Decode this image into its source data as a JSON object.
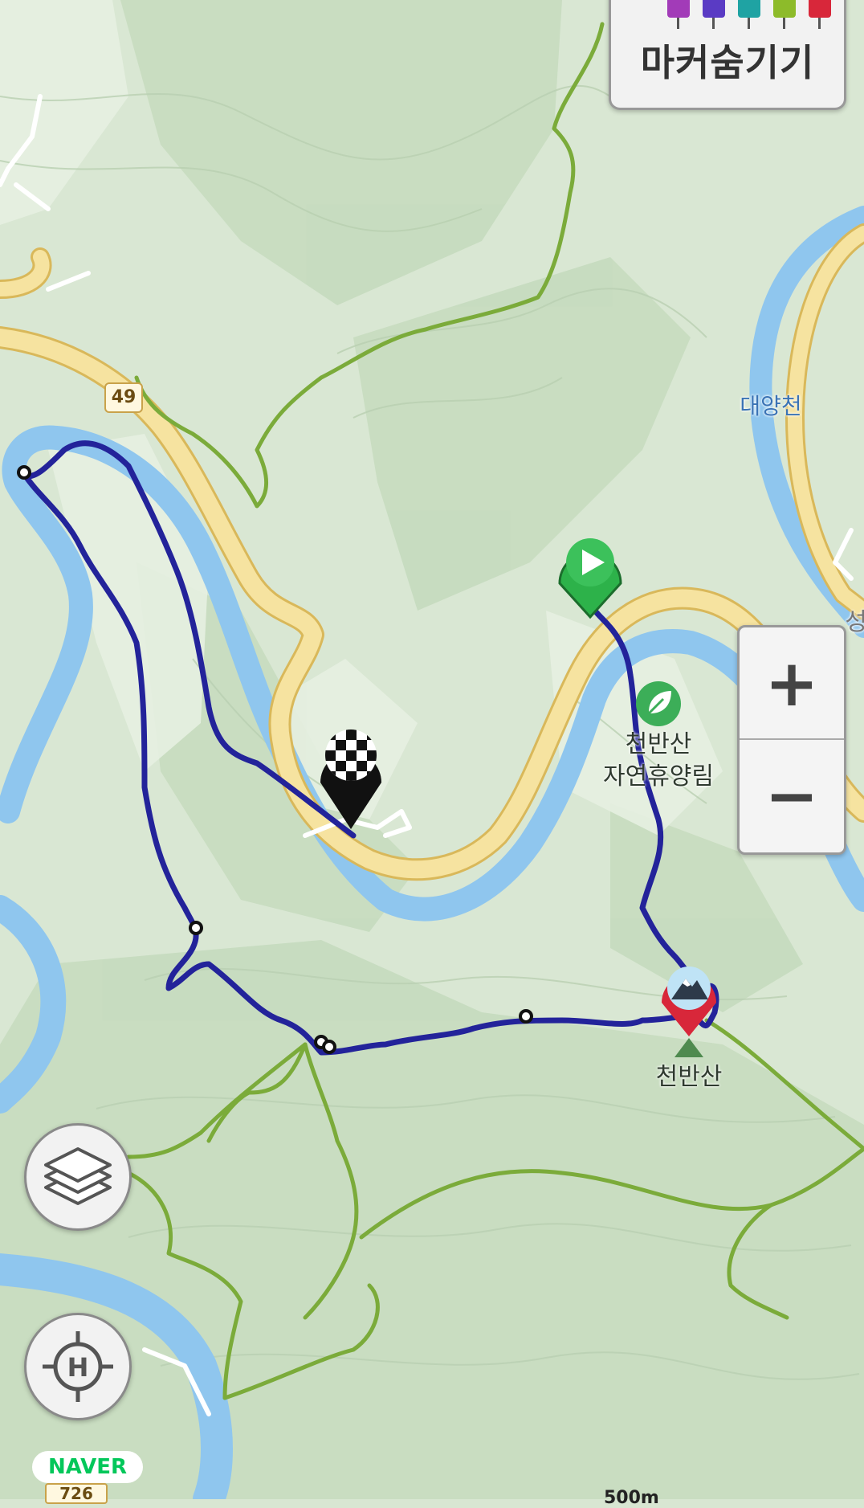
{
  "map": {
    "places": {
      "river_name": "대양천",
      "forest_name_line1": "천반산",
      "forest_name_line2": "자연휴양림",
      "peak_name": "천반산",
      "partial_label": "성"
    },
    "roads": {
      "route_49": "49",
      "route_726": "726"
    },
    "scale_label": "500m",
    "brand": "NAVER"
  },
  "marker_panel": {
    "label": "마커숨기기",
    "icons": [
      {
        "name": "photo-marker-icon",
        "color": "#a23bb8"
      },
      {
        "name": "video-marker-icon",
        "color": "#5a3bc4"
      },
      {
        "name": "audio-marker-icon",
        "color": "#1fa3a3"
      },
      {
        "name": "memo-marker-icon",
        "color": "#8dbb2a"
      },
      {
        "name": "flag-marker-icon",
        "color": "#d8273a"
      }
    ]
  },
  "controls": {
    "zoom_in": "+",
    "zoom_out": "−"
  },
  "colors": {
    "track": "#23239a",
    "trail": "#7bab3a",
    "river": "#8fc6ee",
    "road": "#f6e3a0",
    "start_marker": "#2db24a",
    "summit_marker": "#d8273a"
  }
}
